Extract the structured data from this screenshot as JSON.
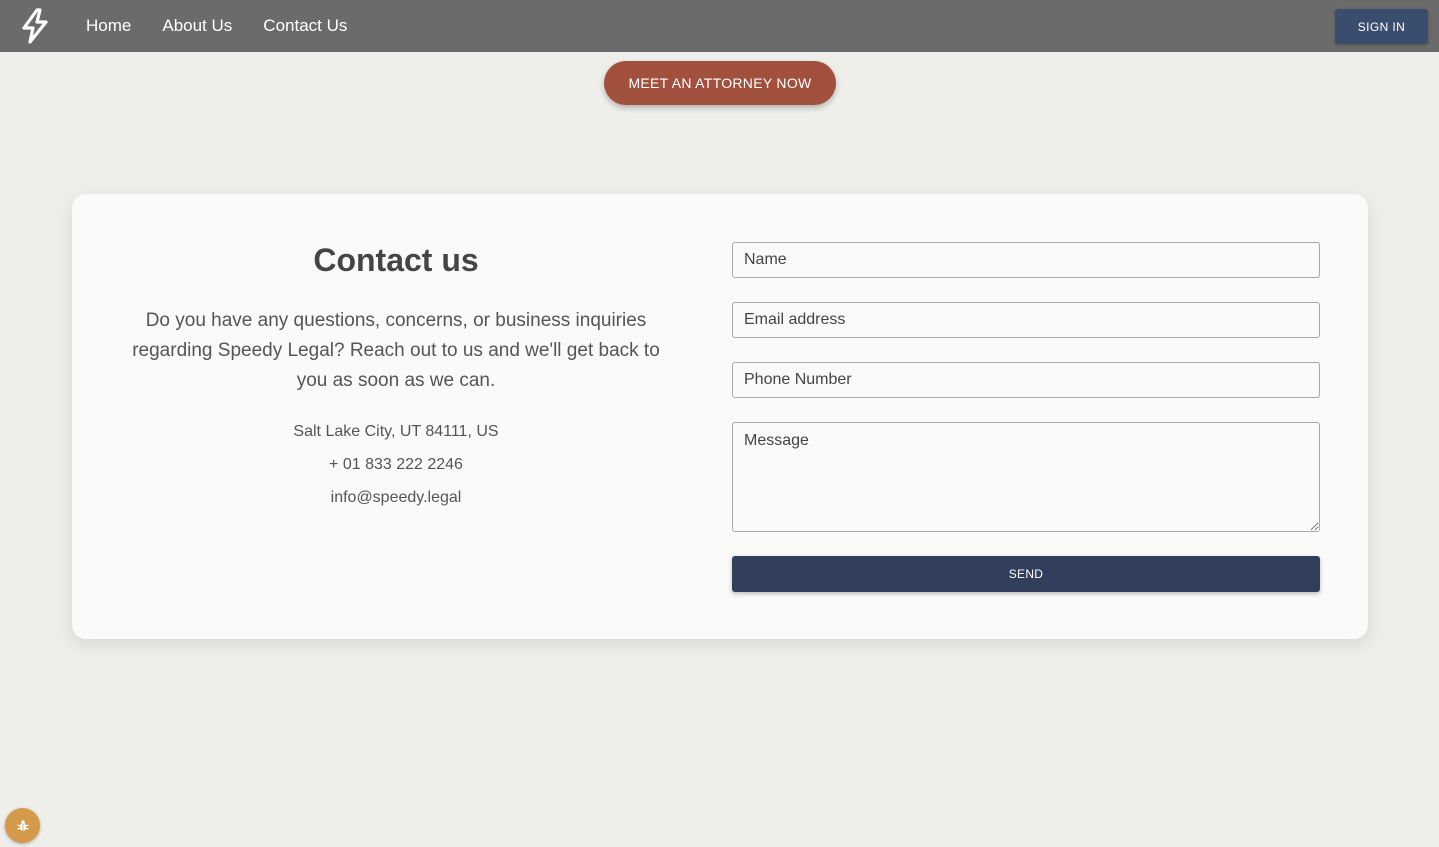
{
  "nav": {
    "logo_icon": "lightning-bolt-icon",
    "links": [
      "Home",
      "About Us",
      "Contact Us"
    ],
    "signin_label": "SIGN IN"
  },
  "cta": {
    "meet_label": "MEET AN ATTORNEY NOW"
  },
  "contact": {
    "title": "Contact us",
    "description": "Do you have any questions, concerns, or business inquiries regarding Speedy Legal? Reach out to us and we'll get back to you as soon as we can.",
    "address": "Salt Lake City, UT 84111, US",
    "phone": "+ 01 833 222 2246",
    "email": "info@speedy.legal"
  },
  "form": {
    "name_placeholder": "Name",
    "email_placeholder": "Email address",
    "phone_placeholder": "Phone Number",
    "message_placeholder": "Message",
    "send_label": "SEND"
  },
  "colors": {
    "navbar": "#6b6b6b",
    "background": "#eeeeea",
    "cta": "#a0503c",
    "primary": "#313f5c"
  },
  "debug": {
    "icon": "bug-icon"
  }
}
